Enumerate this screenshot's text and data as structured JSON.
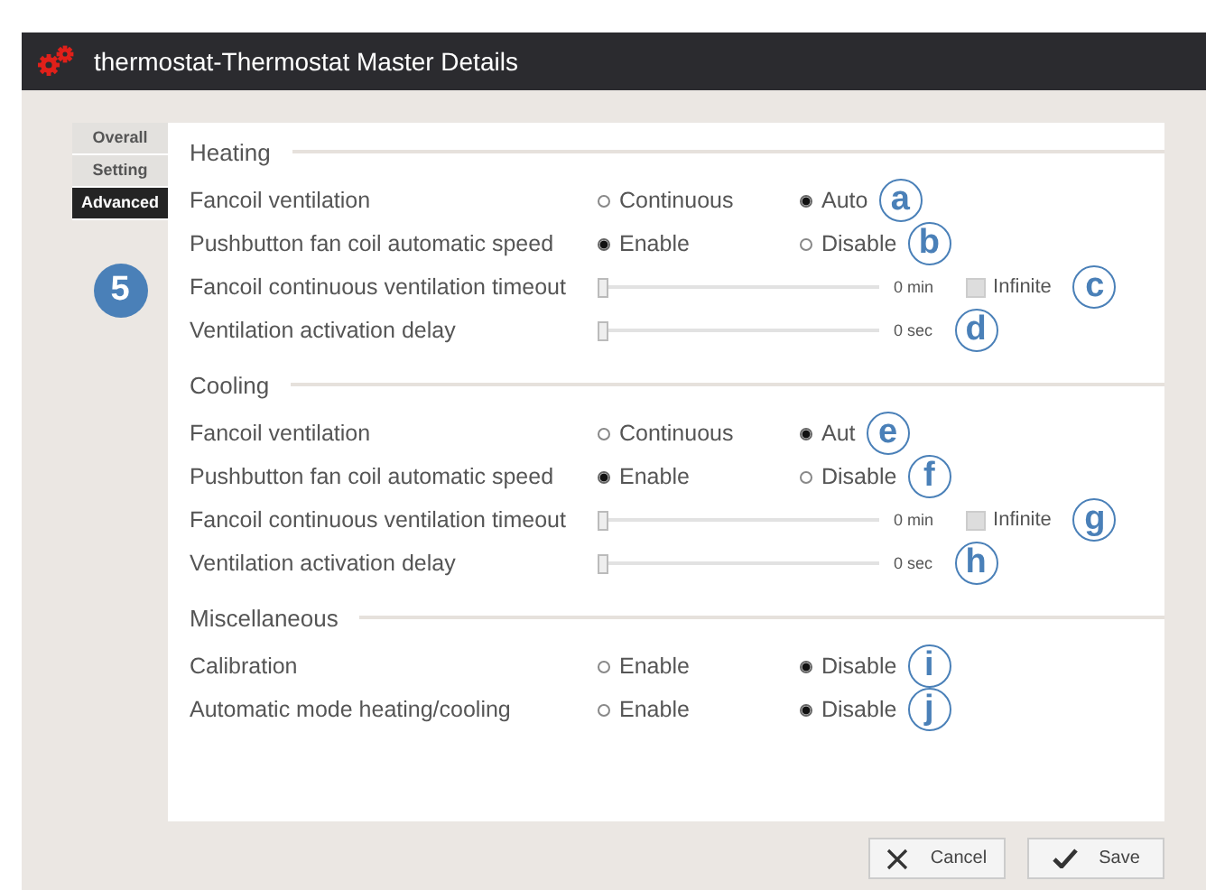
{
  "window": {
    "title": "thermostat-Thermostat Master Details"
  },
  "tabs": [
    {
      "label": "Overall",
      "selected": false
    },
    {
      "label": "Setting",
      "selected": false
    },
    {
      "label": "Advanced",
      "selected": true
    }
  ],
  "step_badge": "5",
  "sections": [
    {
      "title": "Heating",
      "rows": [
        {
          "kind": "radio",
          "label": "Fancoil ventilation",
          "options": [
            {
              "label": "Continuous",
              "selected": false
            },
            {
              "label": "Auto",
              "selected": true
            }
          ],
          "callout": "a"
        },
        {
          "kind": "radio",
          "label": "Pushbutton fan coil automatic speed",
          "options": [
            {
              "label": "Enable",
              "selected": true
            },
            {
              "label": "Disable",
              "selected": false
            }
          ],
          "callout": "b"
        },
        {
          "kind": "slider",
          "label": "Fancoil continuous ventilation timeout",
          "level": 0,
          "reading": "0 min",
          "checkbox": {
            "label": "Infinite",
            "checked": false
          },
          "callout": "c"
        },
        {
          "kind": "slider",
          "label": "Ventilation activation delay",
          "level": 0,
          "reading": "0 sec",
          "callout": "d"
        }
      ]
    },
    {
      "title": "Cooling",
      "rows": [
        {
          "kind": "radio",
          "label": "Fancoil ventilation",
          "options": [
            {
              "label": "Continuous",
              "selected": false
            },
            {
              "label": "Aut",
              "selected": true
            }
          ],
          "callout": "e"
        },
        {
          "kind": "radio",
          "label": "Pushbutton fan coil automatic speed",
          "options": [
            {
              "label": "Enable",
              "selected": true
            },
            {
              "label": "Disable",
              "selected": false
            }
          ],
          "callout": "f"
        },
        {
          "kind": "slider",
          "label": "Fancoil continuous ventilation timeout",
          "level": 0,
          "reading": "0 min",
          "checkbox": {
            "label": "Infinite",
            "checked": false
          },
          "callout": "g"
        },
        {
          "kind": "slider",
          "label": "Ventilation activation delay",
          "level": 0,
          "reading": "0 sec",
          "callout": "h"
        }
      ]
    },
    {
      "title": "Miscellaneous",
      "rows": [
        {
          "kind": "radio",
          "label": "Calibration",
          "options": [
            {
              "label": "Enable",
              "selected": false
            },
            {
              "label": "Disable",
              "selected": true
            }
          ],
          "callout": "i"
        },
        {
          "kind": "radio",
          "label": "Automatic mode heating/cooling",
          "options": [
            {
              "label": "Enable",
              "selected": false
            },
            {
              "label": "Disable",
              "selected": true
            }
          ],
          "callout": "j"
        }
      ]
    }
  ],
  "buttons": [
    {
      "kind": "cancel",
      "label": "Cancel"
    },
    {
      "kind": "save",
      "label": "Save"
    }
  ]
}
